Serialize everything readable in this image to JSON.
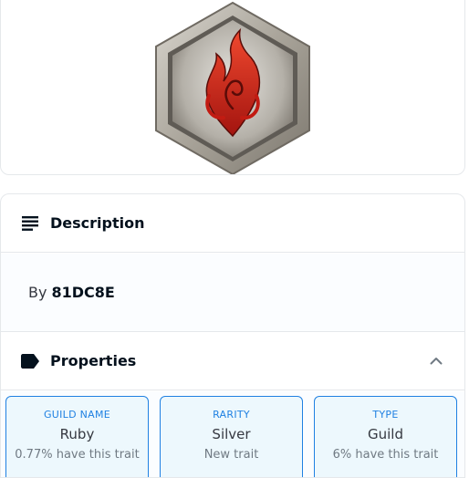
{
  "description": {
    "header_label": "Description",
    "by_label": "By",
    "creator": "81DC8E",
    "icon": "subject-lines-icon"
  },
  "properties": {
    "header_label": "Properties",
    "icon": "label-tag-icon",
    "toggle_icon": "chevron-up-icon",
    "traits": [
      {
        "type": "GUILD NAME",
        "value": "Ruby",
        "rarity": "0.77% have this trait"
      },
      {
        "type": "RARITY",
        "value": "Silver",
        "rarity": "New trait"
      },
      {
        "type": "TYPE",
        "value": "Guild",
        "rarity": "6% have this trait"
      }
    ]
  },
  "image": {
    "icon": "fire-emblem-icon",
    "colors": {
      "accent": "#2081e2",
      "flame": "#d8271c",
      "frame": "#b9b4ab"
    }
  }
}
